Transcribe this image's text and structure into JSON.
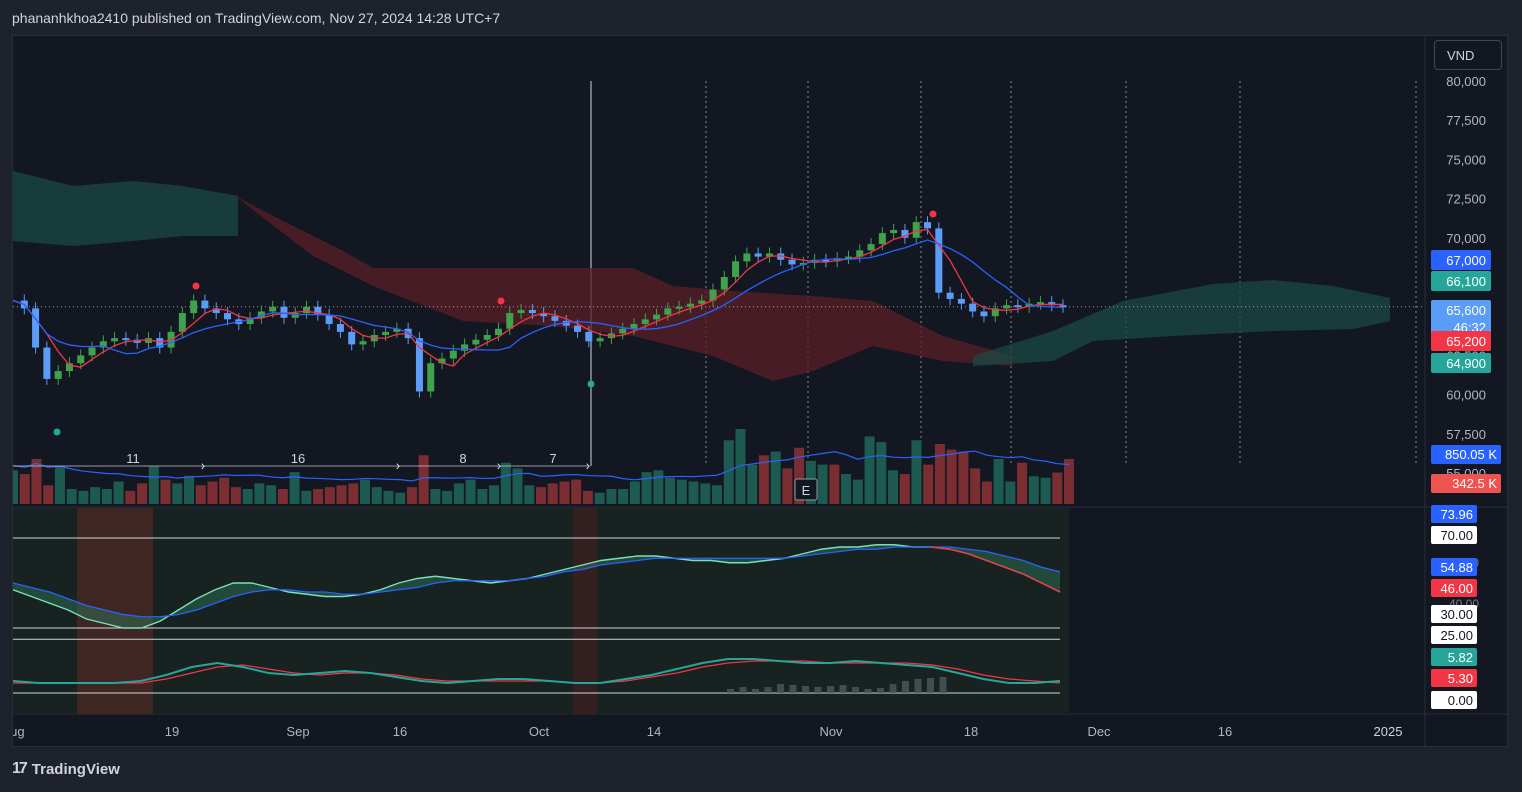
{
  "header": {
    "publisher": "phananhkhoa2410 published on TradingView.com, Nov 27, 2024 14:28 UTC+7"
  },
  "currency_button": "VND",
  "footer": {
    "brand": "TradingView",
    "logo_glyph": "17"
  },
  "earnings_marker": "E",
  "colors": {
    "up": "#26a69a",
    "down": "#ef5350",
    "bull_candle": "#3fa34d",
    "bear_candle": "#5b9cf6",
    "tenkan": "#f23645",
    "kijun": "#2962ff",
    "cloud_green": "#1b4a43",
    "cloud_red": "#5a1f25"
  },
  "chart_data": [
    {
      "type": "candlestick",
      "title": "",
      "price_axis": {
        "ticks": [
          "80,000",
          "77,500",
          "75,000",
          "72,500",
          "70,000",
          "67,500",
          "65,000",
          "62,500",
          "60,000",
          "57,500",
          "55,000"
        ],
        "ylim": [
          55000,
          80000
        ]
      },
      "x_axis": {
        "ticks": [
          "Aug",
          "19",
          "Sep",
          "16",
          "Oct",
          "14",
          "Nov",
          "18",
          "Dec",
          "16",
          "2025"
        ]
      },
      "price_labels": [
        {
          "text": "67,000",
          "color": "#2962ff"
        },
        {
          "text": "66,100",
          "color": "#26a69a"
        },
        {
          "text": "65,600",
          "sub": "46:32",
          "color": "#5b9cf6"
        },
        {
          "text": "65,200",
          "color": "#f23645"
        },
        {
          "text": "64,900",
          "color": "#26a69a"
        }
      ],
      "last_price": 65600,
      "close_series": [
        66000,
        65500,
        63000,
        61000,
        61500,
        62000,
        62500,
        63000,
        63400,
        63600,
        63500,
        63300,
        63600,
        63000,
        64000,
        65200,
        66000,
        65500,
        65200,
        64800,
        64500,
        64900,
        65300,
        65600,
        64900,
        65200,
        65600,
        65100,
        64500,
        64000,
        63200,
        63400,
        63800,
        64000,
        64200,
        63600,
        60200,
        62000,
        62300,
        62800,
        63200,
        63500,
        63800,
        64200,
        65200,
        65400,
        65200,
        65000,
        64700,
        64400,
        64000,
        63400,
        63600,
        63900,
        64200,
        64500,
        64800,
        65100,
        65500,
        65600,
        65800,
        66000,
        66700,
        67500,
        68500,
        69000,
        68800,
        69000,
        68600,
        68300,
        68400,
        68600,
        68500,
        68700,
        68800,
        69200,
        69600,
        70300,
        70500,
        70000,
        71000,
        70600,
        66500,
        66100,
        65800,
        65300,
        65000,
        65500,
        65700,
        65600,
        65800,
        65900,
        65700,
        65600
      ],
      "candles_count": 80,
      "ichimoku_cloud": "green cloud ahead, red cloud Aug-Oct",
      "markers": {
        "red_dots": 3,
        "green_dots": 2
      }
    },
    {
      "type": "bar",
      "title": "Volume",
      "labels": [
        {
          "text": "850.05 K",
          "color": "#2962ff"
        },
        {
          "text": "342.5 K",
          "color": "#ef5350"
        }
      ],
      "count_labels": [
        "11",
        "16",
        "8",
        "7"
      ],
      "values": [
        900,
        800,
        1200,
        500,
        1000,
        400,
        350,
        450,
        400,
        600,
        350,
        550,
        1000,
        650,
        550,
        750,
        500,
        600,
        700,
        450,
        400,
        550,
        500,
        400,
        850,
        350,
        400,
        450,
        500,
        550,
        650,
        450,
        350,
        300,
        450,
        1300,
        400,
        350,
        550,
        650,
        400,
        500,
        1100,
        950,
        500,
        450,
        550,
        600,
        650,
        350,
        300,
        400,
        400,
        600,
        850,
        900,
        700,
        650,
        600,
        550,
        500,
        1700,
        2000,
        1050,
        1300,
        1400,
        950,
        1500,
        1150,
        1050,
        1050,
        800,
        650,
        1800,
        1650,
        900,
        800,
        1700,
        1050,
        1600,
        1450,
        1400,
        950,
        600,
        1200,
        600,
        1100,
        740,
        700,
        840,
        1200
      ]
    },
    {
      "type": "line",
      "title": "",
      "labels": [
        {
          "text": "73.96",
          "color": "#2962ff"
        },
        {
          "text": "70.00",
          "color": "#ffffff"
        },
        {
          "text": "54.88",
          "color": "#2962ff"
        },
        {
          "text": "46.00",
          "color": "#f23645"
        },
        {
          "text": "30.00",
          "color": "#ffffff"
        },
        {
          "text": "25.00",
          "color": "#ffffff"
        },
        {
          "text": "5.82",
          "color": "#26a69a"
        },
        {
          "text": "5.30",
          "color": "#f23645"
        },
        {
          "text": "0.00",
          "color": "#ffffff"
        }
      ],
      "ghost_ticks": [
        "60.00",
        "40.00"
      ],
      "levels": [
        70,
        30,
        25,
        0
      ],
      "rsi_fast": [
        47,
        44,
        41,
        38,
        34,
        32,
        30,
        30,
        33,
        38,
        43,
        47,
        50,
        50,
        48,
        46,
        45,
        44,
        44,
        45,
        47,
        50,
        52,
        53,
        52,
        51,
        50,
        51,
        52,
        54,
        56,
        58,
        60,
        61,
        62,
        62,
        61,
        60,
        60,
        59,
        59,
        60,
        61,
        63,
        65,
        66,
        66,
        67,
        67,
        66,
        66,
        65,
        63,
        60,
        57,
        54,
        50,
        46
      ],
      "rsi_slow": [
        50,
        48,
        46,
        43,
        40,
        38,
        36,
        35,
        35,
        36,
        38,
        41,
        44,
        46,
        47,
        47,
        46,
        46,
        45,
        45,
        46,
        47,
        48,
        50,
        51,
        51,
        51,
        51,
        52,
        53,
        55,
        56,
        58,
        59,
        60,
        61,
        61,
        61,
        61,
        61,
        61,
        61,
        61,
        62,
        63,
        64,
        65,
        65,
        66,
        66,
        66,
        66,
        65,
        64,
        62,
        60,
        57,
        55
      ],
      "adx": [
        6,
        5,
        5,
        5,
        5,
        6,
        9,
        13,
        15,
        13,
        10,
        9,
        10,
        11,
        10,
        8,
        6,
        5,
        6,
        7,
        7,
        6,
        5,
        5,
        7,
        9,
        12,
        15,
        17,
        17,
        16,
        15,
        15,
        16,
        15,
        14,
        13,
        10,
        7,
        5,
        5,
        6
      ],
      "adx_signal": [
        5,
        5,
        5,
        5,
        5,
        5,
        7,
        10,
        13,
        14,
        12,
        10,
        9,
        10,
        10,
        9,
        7,
        6,
        6,
        6,
        6,
        6,
        5,
        5,
        6,
        8,
        10,
        13,
        15,
        16,
        16,
        16,
        15,
        15,
        15,
        15,
        14,
        12,
        9,
        7,
        6,
        5
      ]
    }
  ]
}
